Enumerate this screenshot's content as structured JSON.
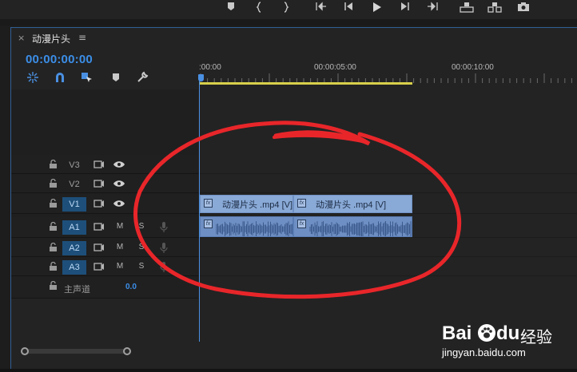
{
  "transport": {
    "icons": [
      "marker-icon",
      "mark-in-icon",
      "mark-out-icon",
      "go-to-in-icon",
      "step-back-icon",
      "play-icon",
      "step-forward-icon",
      "go-to-out-icon",
      "lift-icon",
      "extract-icon",
      "camera-icon"
    ]
  },
  "panel": {
    "close_glyph": "×",
    "title": "动漫片头",
    "menu_glyph": "≡"
  },
  "timecode": "00:00:00:00",
  "ruler": {
    "labels": [
      ":00:00",
      "00:00:05:00",
      "00:00:10:00"
    ]
  },
  "tracks": {
    "video": [
      {
        "name": "V3",
        "selected": false
      },
      {
        "name": "V2",
        "selected": false
      },
      {
        "name": "V1",
        "selected": true
      }
    ],
    "audio": [
      {
        "name": "A1",
        "selected": true,
        "mute": "M",
        "solo": "S"
      },
      {
        "name": "A2",
        "selected": true,
        "mute": "M",
        "solo": "S"
      },
      {
        "name": "A3",
        "selected": true,
        "mute": "M",
        "solo": "S"
      }
    ],
    "master": {
      "label": "主声道",
      "value": "0.0"
    }
  },
  "clips": {
    "video": [
      {
        "label": "动漫片头 .mp4 [V]"
      },
      {
        "label": "动漫片头 .mp4 [V]"
      }
    ],
    "fx_glyph": "fx"
  },
  "watermark": {
    "brand": "Bai",
    "brand2": "du",
    "jingyan": "经验",
    "url": "jingyan.baidu.com"
  },
  "colors": {
    "accent": "#3b8ee8",
    "clip_video": "#89a9d6",
    "clip_audio": "#6e8fc3",
    "work_area": "#d8d04b",
    "annotation": "#e8262a"
  }
}
